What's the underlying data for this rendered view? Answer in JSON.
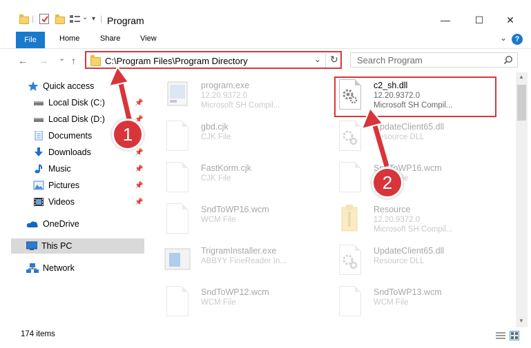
{
  "window": {
    "title": "Program",
    "minimize_glyph": "—",
    "maximize_glyph": "☐",
    "close_glyph": "✕"
  },
  "ribbon": {
    "file": "File",
    "tabs": [
      "Home",
      "Share",
      "View"
    ],
    "expand_glyph": "⌄",
    "help_glyph": "?"
  },
  "navigation": {
    "back_glyph": "←",
    "forward_glyph": "→",
    "recent_glyph": "⌄",
    "up_glyph": "↑"
  },
  "address": {
    "path": "C:\\Program Files\\Program Directory",
    "dropdown_glyph": "⌄",
    "refresh_glyph": "↻"
  },
  "search": {
    "placeholder": "Search Program",
    "icon": "search-icon"
  },
  "sidebar": {
    "items": [
      {
        "label": "Quick access",
        "icon": "star-icon",
        "pinned": false
      },
      {
        "label": "Local Disk (C:)",
        "icon": "drive-icon",
        "pinned": true
      },
      {
        "label": "Local Disk (D:)",
        "icon": "drive-icon",
        "pinned": true
      },
      {
        "label": "Documents",
        "icon": "documents-icon",
        "pinned": true
      },
      {
        "label": "Downloads",
        "icon": "download-icon",
        "pinned": true
      },
      {
        "label": "Music",
        "icon": "music-icon",
        "pinned": true
      },
      {
        "label": "Pictures",
        "icon": "pictures-icon",
        "pinned": true
      },
      {
        "label": "Videos",
        "icon": "videos-icon",
        "pinned": true
      },
      {
        "label": "OneDrive",
        "icon": "cloud-icon",
        "pinned": false
      },
      {
        "label": "This PC",
        "icon": "computer-icon",
        "pinned": false,
        "selected": true
      },
      {
        "label": "Network",
        "icon": "network-icon",
        "pinned": false
      }
    ]
  },
  "files": [
    {
      "name": "program.exe",
      "line1": "12.20.9372.0",
      "line2": "Microsoft SH Compil...",
      "faded": true,
      "icon": "exe-icon"
    },
    {
      "name": "c2_sh.dll",
      "line1": "12.20.9372.0",
      "line2": "Microsoft SH Compil...",
      "faded": false,
      "icon": "dll-gear-icon"
    },
    {
      "name": "gbd.cjk",
      "line1": "CJK File",
      "line2": "",
      "faded": true,
      "icon": "document-icon"
    },
    {
      "name": "UpdateClient65.dll",
      "line1": "Resource DLL",
      "line2": "",
      "faded": true,
      "icon": "dll-gear-icon"
    },
    {
      "name": "FastKorm.cjk",
      "line1": "CJK File",
      "line2": "",
      "faded": true,
      "icon": "document-icon"
    },
    {
      "name": "SndToWP16.wcm",
      "line1": "WCM File",
      "line2": "",
      "faded": true,
      "icon": "document-icon"
    },
    {
      "name": "SndToWP16.wcm",
      "line1": "WCM File",
      "line2": "",
      "faded": true,
      "icon": "document-icon"
    },
    {
      "name": "Resource",
      "line1": "12.20.9372.0",
      "line2": "Microsoft SH Compil...",
      "faded": true,
      "icon": "resource-icon"
    },
    {
      "name": "TrigramInstaller.exe",
      "line1": "ABBYY FineReader In...",
      "line2": "",
      "faded": true,
      "icon": "installer-icon"
    },
    {
      "name": "UpdateClient65.dll",
      "line1": "Resource DLL",
      "line2": "",
      "faded": true,
      "icon": "dll-gear-icon"
    },
    {
      "name": "SndToWP12.wcm",
      "line1": "WCM File",
      "line2": "",
      "faded": true,
      "icon": "document-icon"
    },
    {
      "name": "SndToWP13.wcm",
      "line1": "WCM File",
      "line2": "",
      "faded": true,
      "icon": "document-icon"
    }
  ],
  "status": {
    "count": "174 items"
  },
  "annotations": {
    "badge1": "1",
    "badge2": "2",
    "color": "#d8353a"
  }
}
